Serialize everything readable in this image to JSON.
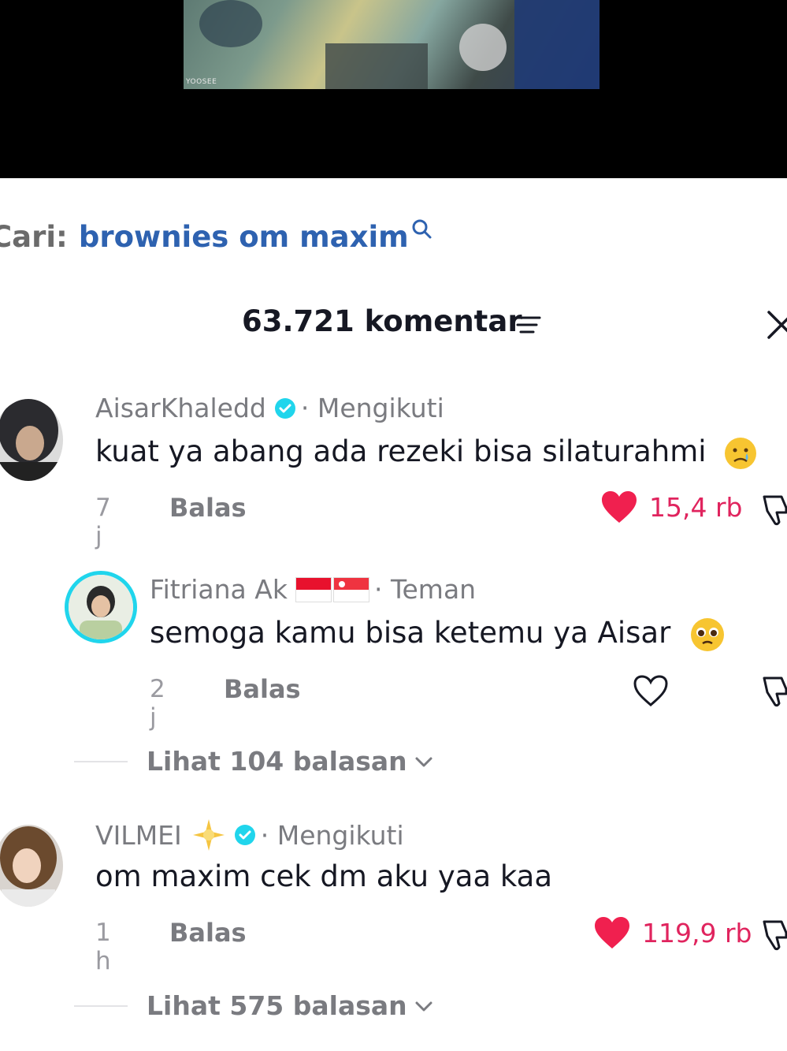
{
  "video": {
    "watermark": "YOOSEE"
  },
  "search": {
    "prefix": "Cari:",
    "query": "brownies om maxim"
  },
  "header": {
    "comment_count": "63.721 komentar"
  },
  "comments": [
    {
      "username": "AisarKhaledd",
      "relation": "· Mengikuti",
      "text": "kuat ya abang ada rezeki bisa silaturahmi",
      "time": "7 j",
      "reply_label": "Balas",
      "likes": "15,4 rb",
      "liked": true
    },
    {
      "username": "Fitriana Ak",
      "relation": "· Teman",
      "text": "semoga kamu bisa ketemu ya Aisar",
      "time": "2 j",
      "reply_label": "Balas",
      "likes": "",
      "liked": false
    },
    {
      "username": "VILMEI",
      "relation": "· Mengikuti",
      "text": "om maxim cek dm aku yaa kaa",
      "time": "1 h",
      "reply_label": "Balas",
      "likes": "119,9 rb",
      "liked": true
    }
  ],
  "view_replies": [
    {
      "label": "Lihat 104 balasan"
    },
    {
      "label": "Lihat 575 balasan"
    }
  ],
  "colors": {
    "like": "#e0245e",
    "link": "#2e62b0",
    "verified": "#20d5ec"
  }
}
